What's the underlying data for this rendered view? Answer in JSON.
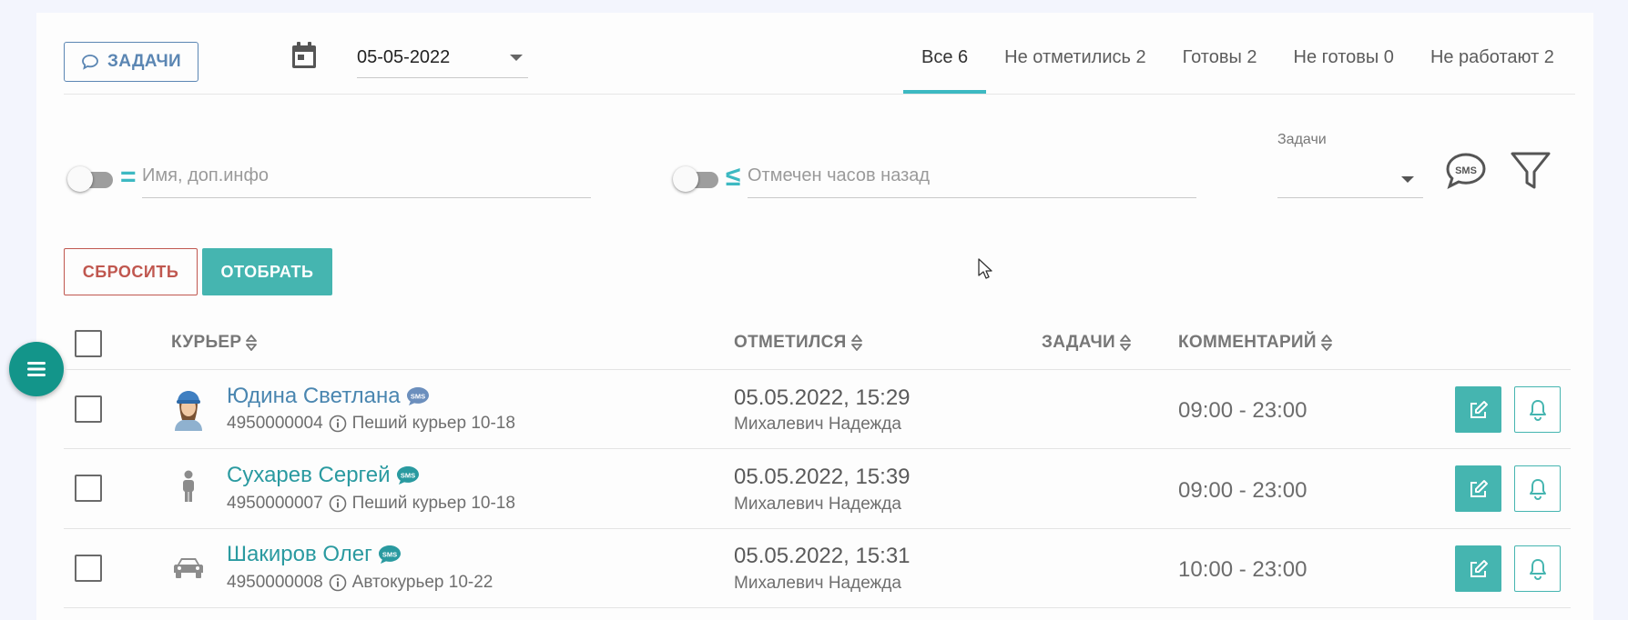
{
  "header": {
    "tasks_button": "ЗАДАЧИ",
    "date_value": "05-05-2022",
    "tabs": [
      {
        "label": "Все 6",
        "active": true
      },
      {
        "label": "Не отметились 2",
        "active": false
      },
      {
        "label": "Готовы 2",
        "active": false
      },
      {
        "label": "Не готовы 0",
        "active": false
      },
      {
        "label": "Не работают 2",
        "active": false
      }
    ]
  },
  "filters": {
    "name_operator": "=",
    "name_placeholder": "Имя, доп.инфо",
    "hours_operator": "≤",
    "hours_placeholder": "Отмечен часов назад",
    "tasks_label": "Задачи",
    "tasks_value": "",
    "reset_button": "СБРОСИТЬ",
    "apply_button": "ОТОБРАТЬ",
    "sms_icon": "sms-icon",
    "filter_icon": "funnel-icon"
  },
  "table": {
    "columns": {
      "courier": "КУРЬЕР",
      "checked_in": "ОТМЕТИЛСЯ",
      "tasks": "ЗАДАЧИ",
      "comment": "КОММЕНТАРИЙ"
    },
    "rows": [
      {
        "name": "Юдина Светлана",
        "phone": "4950000004",
        "type": "Пеший курьер 10-18",
        "time": "05.05.2022, 15:29",
        "by": "Михалевич Надежда",
        "tasks": "",
        "comment": "09:00 - 23:00",
        "avatar": "woman-courier-avatar"
      },
      {
        "name": "Сухарев Сергей",
        "phone": "4950000007",
        "type": "Пеший курьер 10-18",
        "time": "05.05.2022, 15:39",
        "by": "Михалевич Надежда",
        "tasks": "",
        "comment": "09:00 - 23:00",
        "avatar": "person-icon"
      },
      {
        "name": "Шакиров Олег",
        "phone": "4950000008",
        "type": "Автокурьер 10-22",
        "time": "05.05.2022, 15:31",
        "by": "Михалевич Надежда",
        "tasks": "",
        "comment": "10:00 - 23:00",
        "avatar": "car-icon"
      }
    ]
  },
  "colors": {
    "accent": "#45b5b0",
    "tab_underline": "#3db9c2",
    "reset": "#c0574f",
    "link": "#4a86b0"
  }
}
